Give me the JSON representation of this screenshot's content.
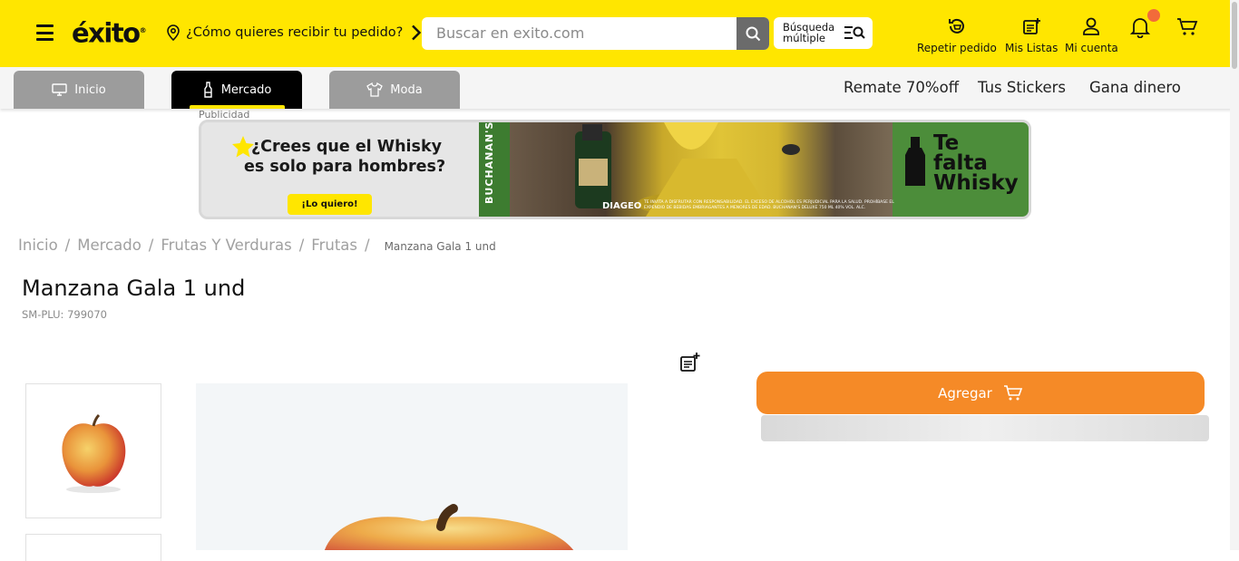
{
  "header": {
    "logo_text": "éxito",
    "logo_mark": "®",
    "location_prompt": "¿Cómo quieres recibir tu pedido?",
    "search_placeholder": "Buscar en exito.com",
    "multi_search_label_line1": "Búsqueda",
    "multi_search_label_line2": "múltiple",
    "actions": [
      {
        "label": "Repetir pedido",
        "icon": "repeat-order-icon"
      },
      {
        "label": "Mis Listas",
        "icon": "lists-icon"
      },
      {
        "label": "Mi cuenta",
        "icon": "user-icon"
      }
    ],
    "notification_icon": "bell-icon",
    "cart_icon": "cart-icon",
    "brand_color": "#ffe600"
  },
  "subnav": {
    "tabs": [
      {
        "label": "Inicio",
        "icon": "monitor-icon",
        "active": false
      },
      {
        "label": "Mercado",
        "icon": "bottle-icon",
        "active": true
      },
      {
        "label": "Moda",
        "icon": "shirt-icon",
        "active": false
      }
    ],
    "links": [
      "Remate 70%off",
      "Tus Stickers",
      "Gana dinero"
    ]
  },
  "ad": {
    "label": "Publicidad",
    "headline_line1": "¿Crees que el Whisky",
    "headline_line2": "es solo para hombres?",
    "cta": "¡Lo quiero!",
    "brand": "BUCHANAN'S",
    "sponsor": "DIAGEO",
    "legal": "TE INVITA A DISFRUTAR CON RESPONSABILIDAD. EL EXCESO DE ALCOHOL ES PERJUDICIAL PARA LA SALUD. PROHÍBASE EL EXPENDIO DE BEBIDAS EMBRIAGANTES A MENORES DE EDAD. BUCHANAN'S DELUXE 750 ML 40% VOL. ALC.",
    "tagline_line1": "Te",
    "tagline_line2": "falta",
    "tagline_line3": "Whisky"
  },
  "breadcrumb": {
    "items": [
      "Inicio",
      "Mercado",
      "Frutas Y Verduras",
      "Frutas"
    ],
    "current": "Manzana Gala 1 und"
  },
  "product": {
    "title": "Manzana Gala 1 und",
    "sku": "SM-PLU: 799070",
    "add_button": "Agregar",
    "accent_color": "#f58a27"
  }
}
